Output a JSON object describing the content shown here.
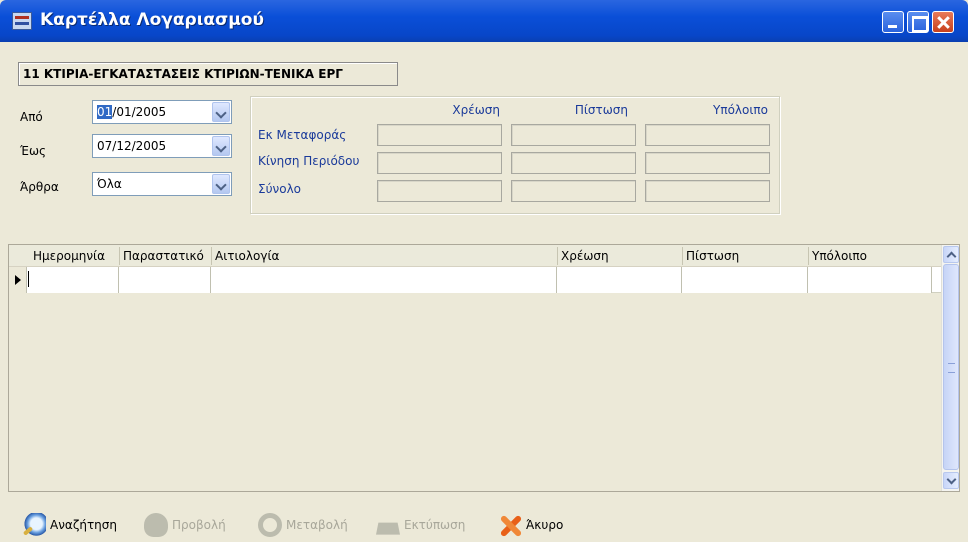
{
  "window": {
    "title": "Καρτέλλα Λογαριασμού"
  },
  "account": {
    "title": "11 ΚΤΙΡΙΑ-ΕΓΚΑΤΑΣΤΑΣΕΙΣ ΚΤΙΡΙΩΝ-ΤΕΝΙΚΑ ΕΡΓ"
  },
  "filters": {
    "from_label": "Από",
    "from_value_selected": "01",
    "from_value_rest": "/01/2005",
    "to_label": "Έως",
    "to_value": "07/12/2005",
    "articles_label": "Άρθρα",
    "articles_value": "Όλα"
  },
  "balances": {
    "headers": [
      "Χρέωση",
      "Πίστωση",
      "Υπόλοιπο"
    ],
    "rows": [
      "Εκ Μεταφοράς",
      "Κίνηση Περιόδου",
      "Σύνολο"
    ]
  },
  "grid": {
    "columns": [
      "Ημερομηνία",
      "Παραστατικό",
      "Αιτιολογία",
      "Χρέωση",
      "Πίστωση",
      "Υπόλοιπο"
    ]
  },
  "toolbar": {
    "search": "Αναζήτηση",
    "view": "Προβολή",
    "change": "Μεταβολή",
    "print": "Εκτύπωση",
    "cancel": "Άκυρο"
  },
  "icons": {
    "title": "card-icon",
    "search": "search-icon",
    "view": "view-icon",
    "change": "change-icon",
    "print": "print-icon",
    "cancel": "cancel-icon"
  }
}
